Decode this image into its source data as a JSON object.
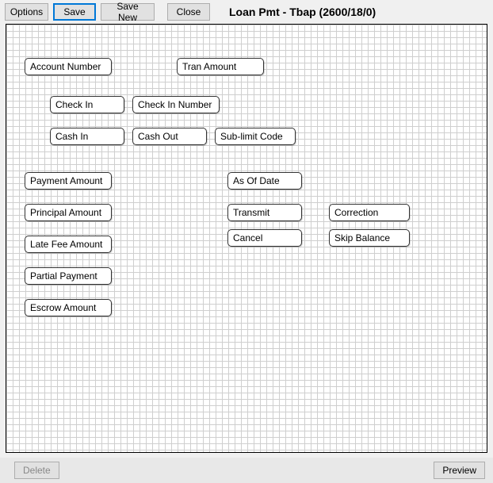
{
  "toolbar": {
    "options_label": "Options",
    "save_label": "Save",
    "save_new_label": "Save New",
    "close_label": "Close"
  },
  "title": "Loan Pmt - Tbap (2600/18/0)",
  "fields": {
    "account_number": "Account Number",
    "tran_amount": "Tran Amount",
    "check_in": "Check In",
    "check_in_number": "Check In Number",
    "cash_in": "Cash In",
    "cash_out": "Cash Out",
    "sub_limit_code": "Sub-limit Code",
    "payment_amount": "Payment Amount",
    "principal_amount": "Principal Amount",
    "late_fee_amount": "Late Fee Amount",
    "partial_payment": "Partial Payment",
    "escrow_amount": "Escrow Amount",
    "as_of_date": "As Of Date",
    "transmit": "Transmit",
    "cancel": "Cancel",
    "correction": "Correction",
    "skip_balance": "Skip Balance"
  },
  "bottom": {
    "delete_label": "Delete",
    "preview_label": "Preview"
  }
}
